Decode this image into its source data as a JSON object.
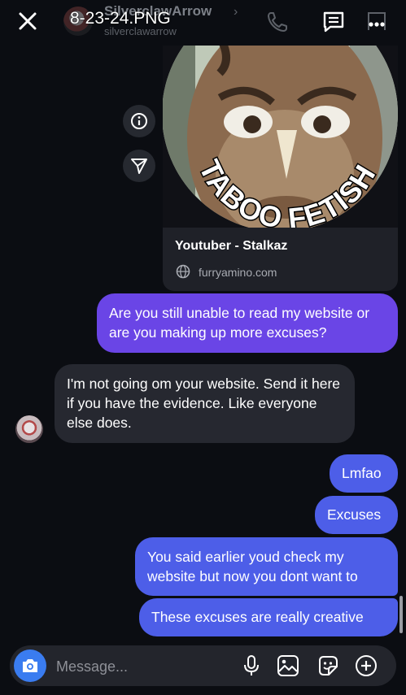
{
  "header": {
    "file_title": "8-23-24.PNG",
    "contact_name": "SilverclawArrow",
    "contact_handle": "silverclawarrow"
  },
  "link_card": {
    "image_text": "TABOO FETISH",
    "title": "Youtuber - Stalkaz",
    "site": "furryamino.com"
  },
  "messages": [
    {
      "side": "out",
      "text": "Are you still unable to read my website or are you making up more excuses?"
    },
    {
      "side": "in",
      "text": "I'm not going om your website. Send it here if you have the evidence. Like everyone else does."
    },
    {
      "side": "out",
      "text": "Lmfao"
    },
    {
      "side": "out",
      "text": "Excuses"
    },
    {
      "side": "out",
      "text": "You said earlier youd check my website but now you dont want to"
    },
    {
      "side": "out",
      "text": "These excuses are really creative"
    }
  ],
  "composer": {
    "placeholder": "Message..."
  },
  "colors": {
    "background": "#0b0d12",
    "outgoing_bubble": "#4d5ee8",
    "outgoing_bubble_top": "#6a45e6",
    "incoming_bubble": "#262830",
    "camera_button": "#3a7cf0"
  },
  "icons": [
    "close-icon",
    "phone-icon",
    "chat-icon",
    "flag-icon",
    "more-icon",
    "info-icon",
    "send-icon",
    "globe-icon",
    "camera-icon",
    "mic-icon",
    "gallery-icon",
    "sticker-icon",
    "plus-icon"
  ]
}
